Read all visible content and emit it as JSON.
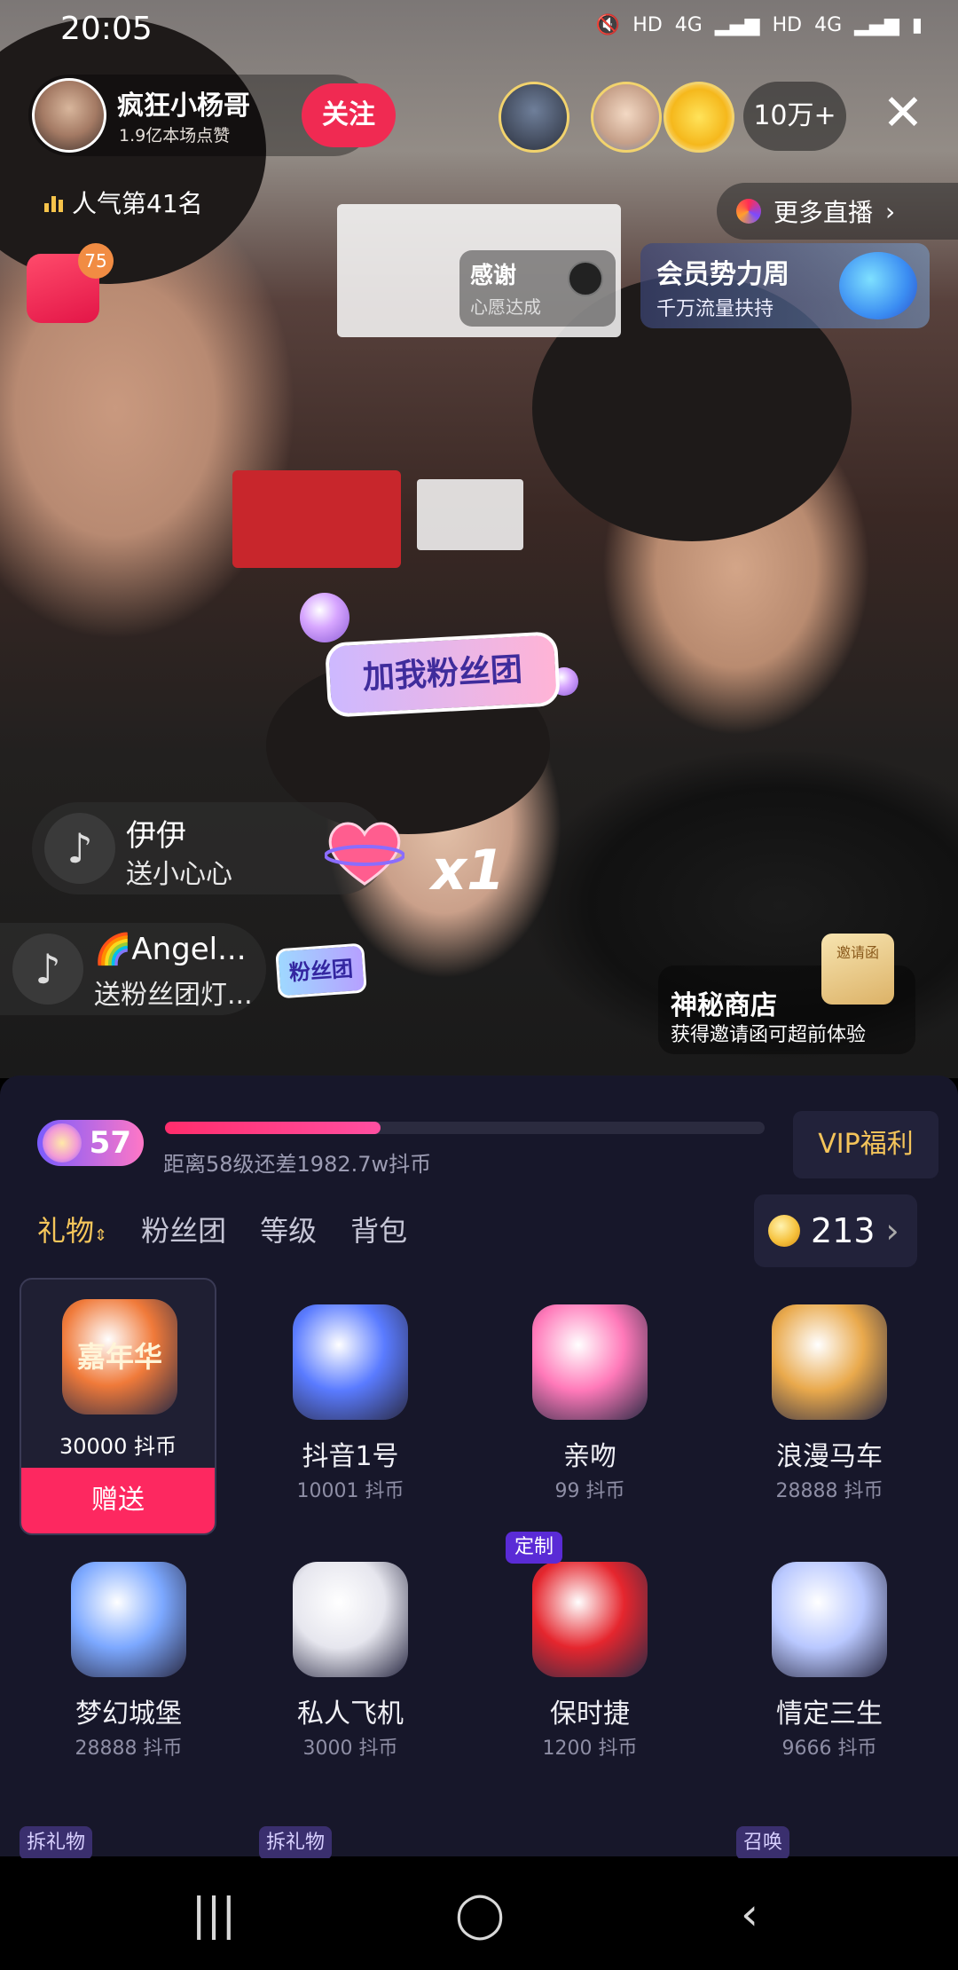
{
  "status": {
    "time": "20:05",
    "net1": "HD",
    "net2": "4G",
    "net3": "HD",
    "net4": "4G"
  },
  "host": {
    "name": "疯狂小杨哥",
    "likes": "1.9亿本场点赞",
    "follow_label": "关注"
  },
  "viewers": {
    "count": "10万+"
  },
  "rank": "人气第41名",
  "envelope_badge": "75",
  "more_live": "更多直播",
  "thanks": {
    "title": "感谢",
    "sub": "心愿达成"
  },
  "member": {
    "title": "会员势力周",
    "sub": "千万流量扶持"
  },
  "stream": {
    "fans_sticker": "加我粉丝团",
    "fan_tag": "粉丝团",
    "gift_count": "x1",
    "gift_msgs": [
      {
        "user": "伊伊",
        "gift": "送小心心"
      },
      {
        "user": "🌈Angel...",
        "gift": "送粉丝团灯..."
      }
    ],
    "shop": {
      "title": "神秘商店",
      "sub": "获得邀请函可超前体验",
      "card": "邀请函"
    }
  },
  "panel": {
    "level": "57",
    "progress": 0.36,
    "progress_text": "距离58级还差1982.7w抖币",
    "vip": "VIP福利",
    "tabs": [
      "礼物",
      "粉丝团",
      "等级",
      "背包"
    ],
    "coins": "213",
    "send_label": "赠送",
    "gifts": [
      {
        "name": "30000 抖币",
        "price": "",
        "icon": "carnival-icon",
        "color": "#f07a3a",
        "art": "嘉年华"
      },
      {
        "name": "抖音1号",
        "price": "10001 抖币",
        "icon": "rocket-icon",
        "color": "#5a7bff"
      },
      {
        "name": "亲吻",
        "price": "99 抖币",
        "icon": "heart-kiss-icon",
        "color": "#ff79b9"
      },
      {
        "name": "浪漫马车",
        "price": "28888 抖币",
        "icon": "carriage-icon",
        "color": "#e9a94c"
      },
      {
        "name": "梦幻城堡",
        "price": "28888 抖币",
        "icon": "castle-icon",
        "color": "#7ca8ff"
      },
      {
        "name": "私人飞机",
        "price": "3000 抖币",
        "icon": "airplane-icon",
        "color": "#e6e6ee"
      },
      {
        "name": "保时捷",
        "price": "1200 抖币",
        "icon": "sports-car-icon",
        "color": "#e5262e",
        "badge": "定制"
      },
      {
        "name": "情定三生",
        "price": "9666 抖币",
        "icon": "couple-icon",
        "color": "#b9c8ff"
      }
    ],
    "next_tags": [
      "拆礼物",
      "拆礼物",
      "召唤"
    ]
  },
  "colors": {
    "accent": "#fd2860",
    "gold": "#f5c65b",
    "panel": "#17172a"
  }
}
